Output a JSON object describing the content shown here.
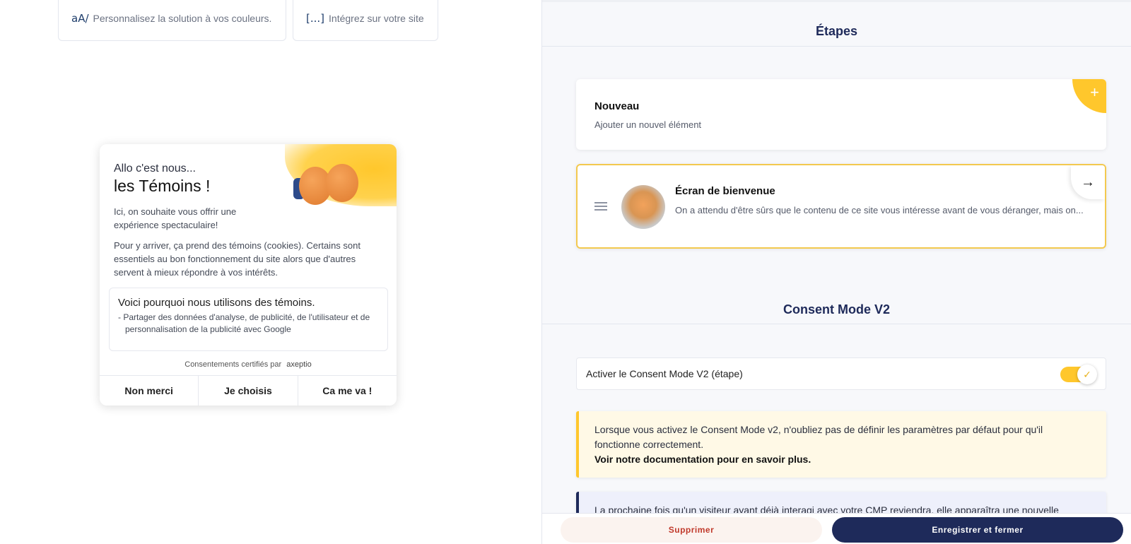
{
  "left": {
    "features": [
      {
        "icon": "aA/",
        "text": "Personnalisez la solution à vos couleurs."
      },
      {
        "icon": "[...]",
        "text": "Intégrez sur votre site"
      }
    ],
    "banner": {
      "hello": "Allo c'est nous...",
      "title": "les Témoins !",
      "p1": "Ici, on souhaite vous offrir une expérience spectaculaire!",
      "p2": "Pour y arriver, ça prend des témoins (cookies). Certains sont essentiels au bon fonctionnement du site alors que d'autres servent à mieux répondre à vos intérêts.",
      "why_title": "Voici pourquoi nous utilisons des témoins.",
      "why_item": "- Partager des données d'analyse, de publicité, de l'utilisateur et de personnalisation de la publicité avec Google",
      "certified": "Consentements certifiés par",
      "brand": "axeptio",
      "buttons": [
        "Non merci",
        "Je choisis",
        "Ca me va !"
      ]
    }
  },
  "right": {
    "steps_title": "Étapes",
    "new_card": {
      "title": "Nouveau",
      "subtitle": "Ajouter un nouvel élément",
      "icon": "+"
    },
    "welcome_card": {
      "title": "Écran de bienvenue",
      "text": "On a attendu d'être sûrs que le contenu de ce site vous intéresse avant de vous déranger, mais on...",
      "arrow": "→"
    },
    "consent_title": "Consent Mode V2",
    "toggle_label": "Activer le Consent Mode V2 (étape)",
    "toggle_on": true,
    "warn_text": "Lorsque vous activez le Consent Mode v2, n'oubliez pas de définir les paramètres par défaut pour qu'il fonctionne correctement.",
    "warn_link": "Voir notre documentation pour en savoir plus.",
    "info_text": "La prochaine fois qu'un visiteur ayant déjà interagi avec votre CMP reviendra, elle apparaîtra une nouvelle",
    "delete_label": "Supprimer",
    "save_label": "Enregistrer et fermer"
  },
  "colors": {
    "accent": "#ffc72c",
    "navy": "#1e2a5a",
    "danger": "#c0392b"
  }
}
